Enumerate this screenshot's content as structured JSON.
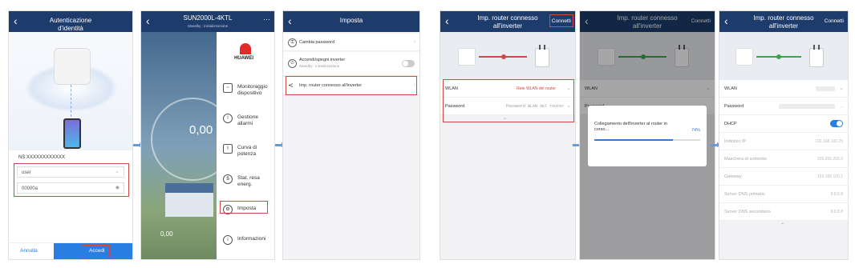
{
  "screen1": {
    "title": "Autenticazione d'identità",
    "ns_label": "NS:XXXXXXXXXXXX",
    "username": "user",
    "password": "00000a",
    "cancel": "Annulla",
    "login": "Accedi"
  },
  "screen2": {
    "title": "SUN2000L-4KTL",
    "subtitle": "Standby : inizializzazione",
    "energy_value": "0,00",
    "bottom_value": "0,00",
    "brand": "HUAWEI",
    "menu": [
      "Monitoraggio dispositivo",
      "Gestione allarmi",
      "Curva di potenza",
      "Stat. resa energ.",
      "Imposta",
      "Informazioni"
    ]
  },
  "screen3": {
    "title": "Imposta",
    "items": [
      {
        "label": "Cambia password"
      },
      {
        "label": "Accendi/spegni inverter",
        "sub": "Standby : inizializzazione"
      },
      {
        "label": "Imp. router connesso all'inverter"
      }
    ]
  },
  "screen4": {
    "title": "Imp. router connesso all'inverter",
    "connect": "Connetti",
    "wlan_label": "WLAN",
    "wlan_value": "Rete WLAN del router",
    "password_label": "Password",
    "password_placeholder": "Password WLAN del router"
  },
  "screen5": {
    "title": "Imp. router connesso all'inverter",
    "connect": "Connetti",
    "wlan_label": "WLAN",
    "password_label": "Password",
    "dialog_text": "Collegamento dell'inverter al router in corso...",
    "progress_text": "74%",
    "progress": 0.74
  },
  "screen6": {
    "title": "Imp. router connesso all'inverter",
    "connect": "Connetti",
    "rows": [
      {
        "label": "WLAN",
        "value": ""
      },
      {
        "label": "Password",
        "value": "..."
      },
      {
        "label": "DHCP",
        "value": ""
      },
      {
        "label": "Indirizzo IP",
        "value": "192.168.100.25"
      },
      {
        "label": "Maschera di sottorete",
        "value": "255.255.255.0"
      },
      {
        "label": "Gateway",
        "value": "192.168.100.1"
      },
      {
        "label": "Server DNS primario",
        "value": "8.8.8.8"
      },
      {
        "label": "Server DNS secondario",
        "value": "8.8.8.8"
      }
    ]
  },
  "colors": {
    "header": "#1d3b6b",
    "accent": "#2a7de1",
    "alert": "#d24848",
    "ok": "#3aa64c"
  }
}
